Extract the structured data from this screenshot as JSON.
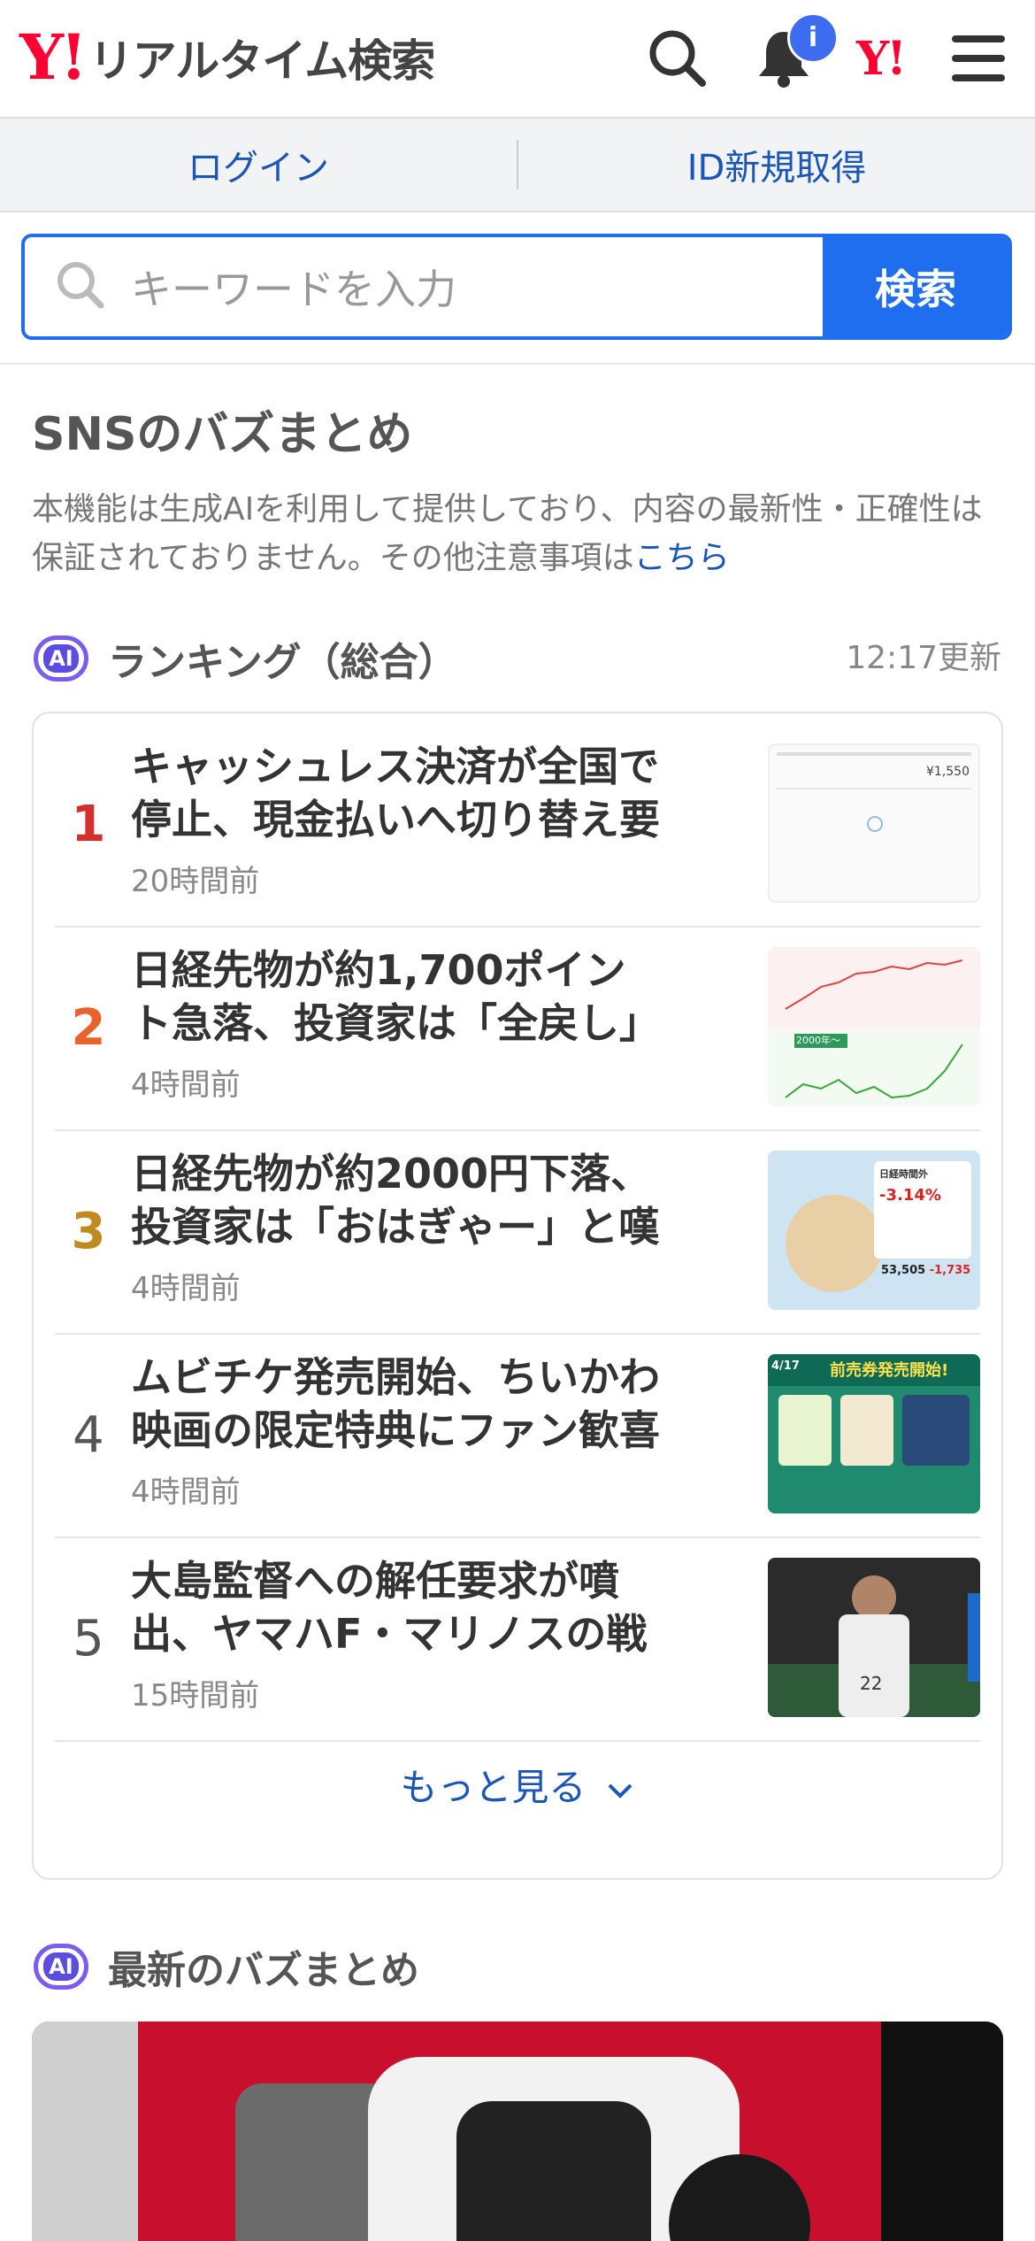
{
  "header": {
    "logo_mark": "Y!",
    "logo_text": "リアルタイム検索",
    "notification_badge": "i",
    "yahoo_mark": "Y!"
  },
  "auth": {
    "login": "ログイン",
    "signup": "ID新規取得"
  },
  "search": {
    "placeholder": "キーワードを入力",
    "button": "検索"
  },
  "sns": {
    "title": "SNSのバズまとめ",
    "note": "本機能は生成AIを利用して提供しており、内容の最新性・正確性は保証されておりません。その他注意事項は",
    "note_link": "こちら"
  },
  "ranking": {
    "ai_label": "AI",
    "title": "ランキング（総合）",
    "updated": "12:17更新",
    "items": [
      {
        "rank": "1",
        "title": "キャッシュレス決済が全国で停止、現金払いへ切り替え要請が...",
        "time": "20時間前",
        "color": "#d32f2f"
      },
      {
        "rank": "2",
        "title": "日経先物が約1,700ポイント急落、投資家は「全戻し」や「大...",
        "time": "4時間前",
        "color": "#e8622a"
      },
      {
        "rank": "3",
        "title": "日経先物が約2000円下落、投資家は「おはぎゃー」と嘆くリス...",
        "time": "4時間前",
        "color": "#c08a1e"
      },
      {
        "rank": "4",
        "title": "ムビチケ発売開始、ちいかわ映画の限定特典にファン歓喜「かわ...",
        "time": "4時間前",
        "color": "#555555"
      },
      {
        "rank": "5",
        "title": "大島監督への解任要求が噴出、ヤマハF・マリノスの戦術不満が...",
        "time": "15時間前",
        "color": "#555555"
      }
    ],
    "more": "もっと見る"
  },
  "thumbs": {
    "t1_price": "¥1,550",
    "t2_tag": "2000年〜",
    "t3_label": "日経時間外",
    "t3_pct": "-3.14%",
    "t3_val": "53,505",
    "t3_chg": "-1,735",
    "t4_banner": "前売券発売開始!",
    "t4_date": "4/17",
    "t5_number": "22"
  },
  "latest": {
    "ai_label": "AI",
    "title": "最新のバズまとめ"
  }
}
